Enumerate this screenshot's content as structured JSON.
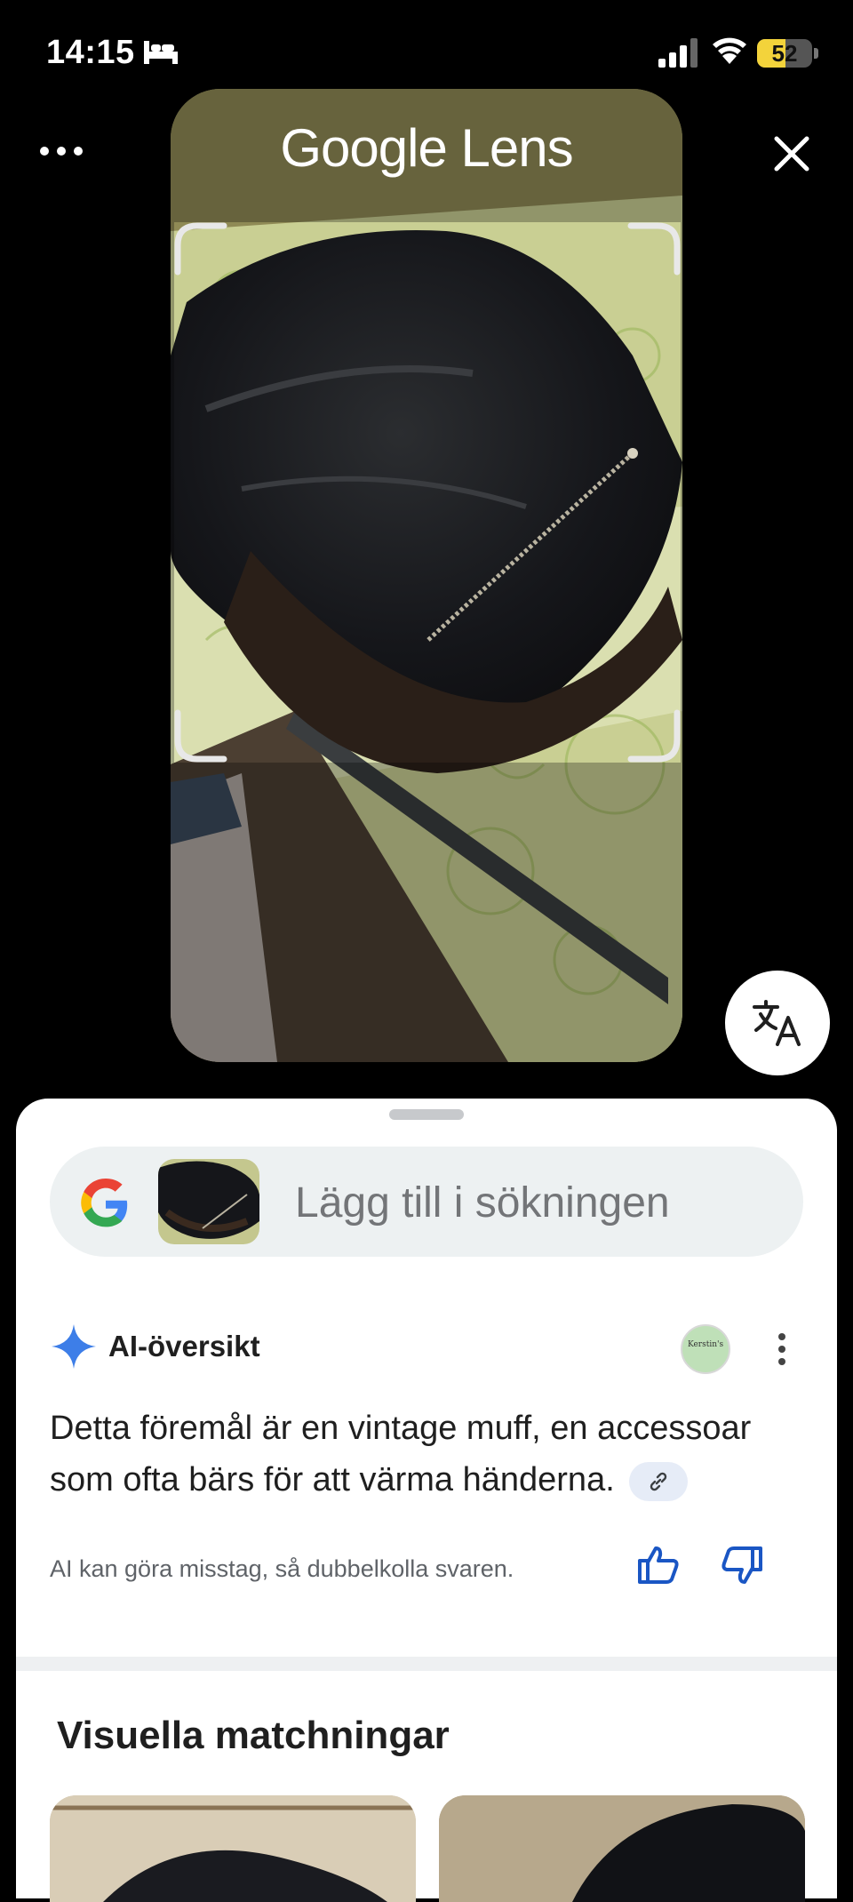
{
  "status_bar": {
    "time": "14:15",
    "battery_level": "52",
    "battery_fraction": 0.52,
    "icons": [
      "bed-icon",
      "signal-icon",
      "wifi-icon",
      "battery-icon"
    ]
  },
  "header": {
    "title": "Google Lens",
    "more_icon": "more-horizontal-icon",
    "close_icon": "close-icon"
  },
  "translate_button": {
    "icon": "translate-icon"
  },
  "sheet": {
    "search": {
      "placeholder": "Lägg till i sökningen",
      "logo": "google-g-icon"
    },
    "ai_overview": {
      "title": "AI-översikt",
      "avatar_text": "Kerstin's",
      "body": "Detta föremål är en vintage muff, en accessoar som ofta bärs för att värma händerna.",
      "disclaimer": "AI kan göra misstag, så dubbelkolla svaren.",
      "icons": [
        "sparkle-icon",
        "link-icon",
        "thumbs-up-icon",
        "thumbs-down-icon",
        "more-vertical-icon"
      ]
    },
    "visual_matches": {
      "title": "Visuella matchningar"
    }
  },
  "colors": {
    "accent_blue": "#1a56c4",
    "sheet_bg": "#ffffff",
    "search_bg": "#edf1f2",
    "battery_yellow": "#f3d33b"
  }
}
